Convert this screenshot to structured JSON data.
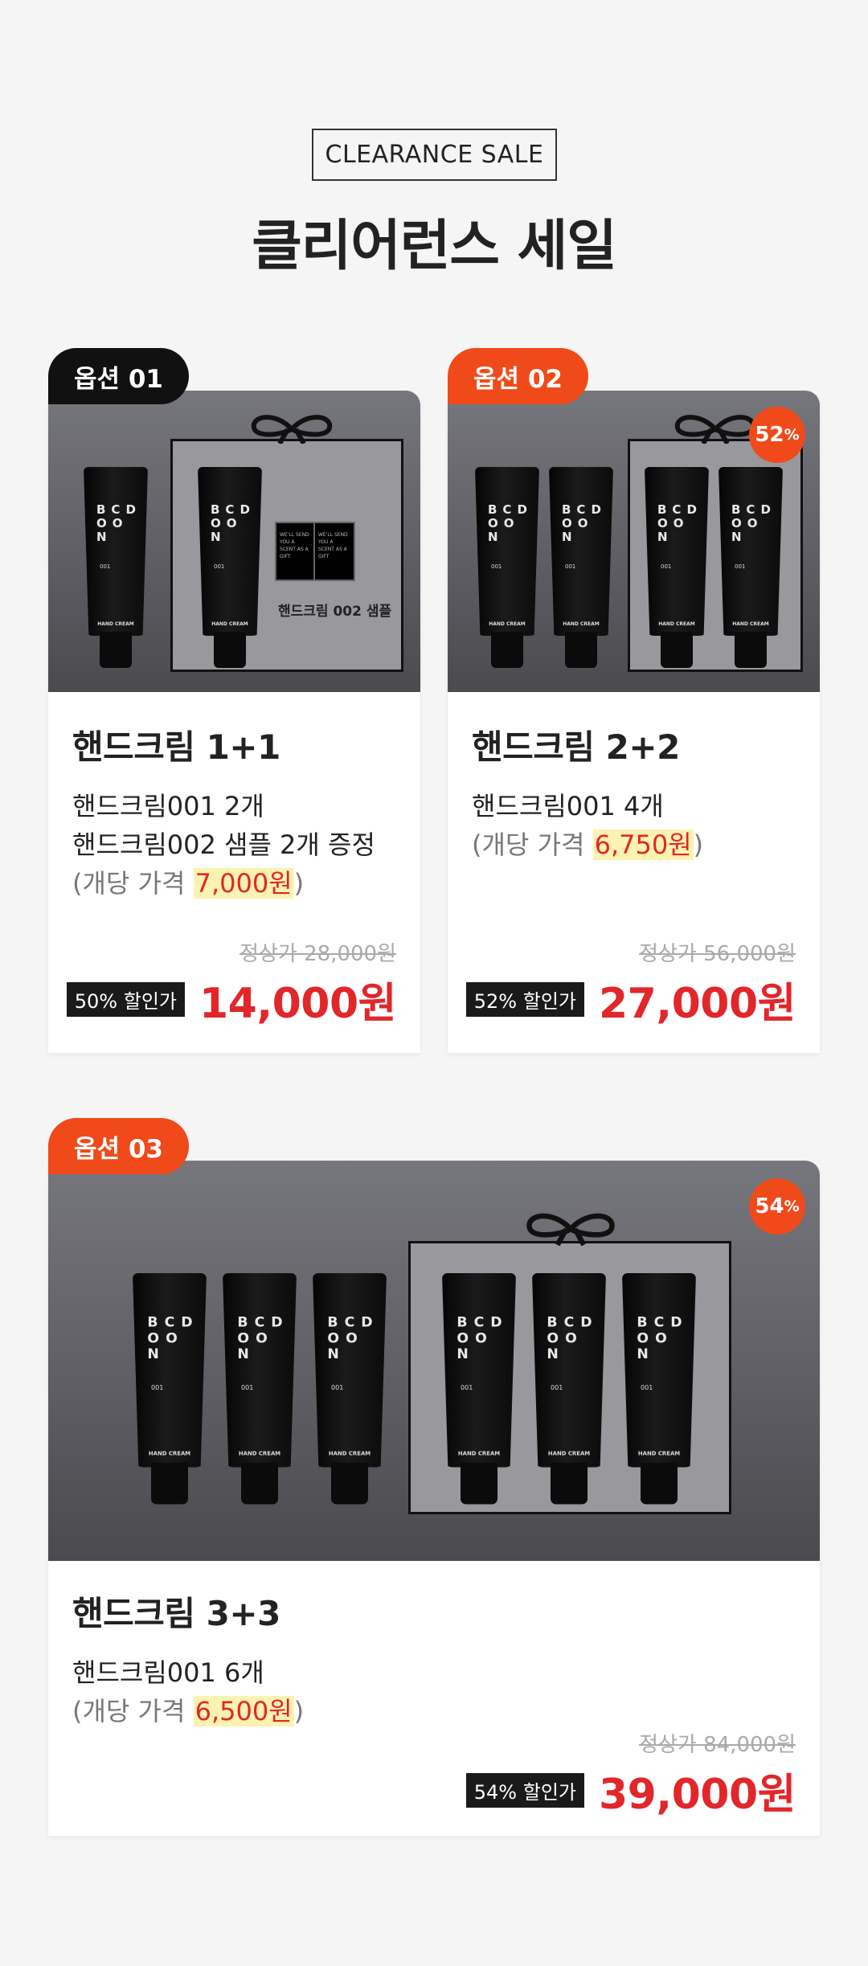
{
  "header": {
    "tag": "CLEARANCE SALE",
    "title": "클리어런스 세일"
  },
  "tube": {
    "logo_line1": "BCD",
    "logo_line2": "OO",
    "logo_line3": "N",
    "number": "001",
    "label": "HAND CREAM"
  },
  "options": [
    {
      "badge": "옵션 01",
      "badge_color": "#111111",
      "title": "핸드크림 1+1",
      "desc_lines": [
        "핸드크림001 2개",
        "핸드크림002 샘플 2개 증정"
      ],
      "unit_prefix": "(개당 가격 ",
      "unit_price": "7,000원",
      "unit_suffix": ")",
      "sample_label": "핸드크림 002 샘플",
      "sample_text": "WE'LL SEND YOU A SCENT AS A GIFT",
      "original_price": "정상가 28,000원",
      "discount_rate": "50% 할인가",
      "price": "14,000원"
    },
    {
      "badge": "옵션 02",
      "badge_color": "#f04a1a",
      "title": "핸드크림 2+2",
      "desc_lines": [
        "핸드크림001 4개"
      ],
      "unit_prefix": "(개당 가격 ",
      "unit_price": "6,750원",
      "unit_suffix": ")",
      "discount_badge": "52",
      "discount_badge_unit": "%",
      "original_price": "정상가 56,000원",
      "discount_rate": "52% 할인가",
      "price": "27,000원"
    },
    {
      "badge": "옵션 03",
      "badge_color": "#f04a1a",
      "title": "핸드크림 3+3",
      "desc_lines": [
        "핸드크림001 6개"
      ],
      "unit_prefix": "(개당 가격 ",
      "unit_price": "6,500원",
      "unit_suffix": ")",
      "discount_badge": "54",
      "discount_badge_unit": "%",
      "original_price": "정상가 84,000원",
      "discount_rate": "54% 할인가",
      "price": "39,000원"
    }
  ],
  "colors": {
    "accent_red": "#e2262a",
    "badge_orange": "#f04a1a",
    "highlight": "#fdf3b0"
  }
}
